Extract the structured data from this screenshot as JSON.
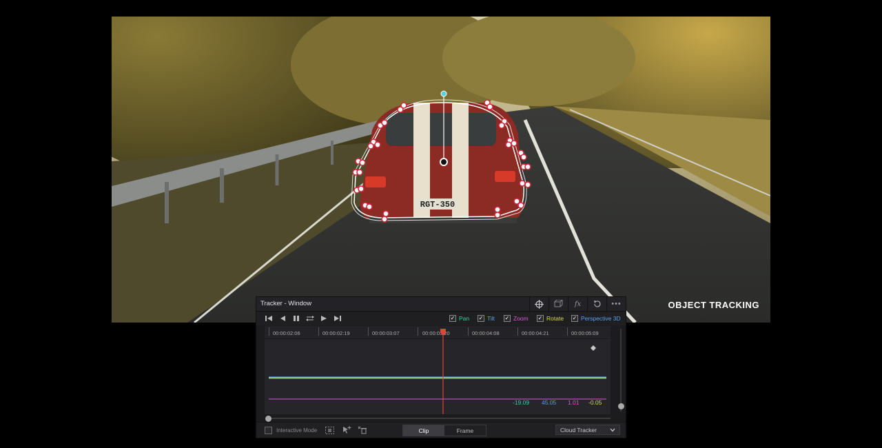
{
  "viewer": {
    "feature_label": "OBJECT TRACKING",
    "plate_text": "RGT-350"
  },
  "tracker": {
    "title": "Tracker - Window",
    "header_icons": [
      "crosshair-icon",
      "cube-icon",
      "fx-icon",
      "reset-icon",
      "more-icon"
    ],
    "transport": [
      "skip-start-icon",
      "step-back-icon",
      "stop-icon",
      "bidirectional-icon",
      "play-icon",
      "skip-end-icon"
    ],
    "options": [
      {
        "label": "Pan",
        "color": "#48c9a0",
        "checked": true
      },
      {
        "label": "Tilt",
        "color": "#5aa0ef",
        "checked": true
      },
      {
        "label": "Zoom",
        "color": "#d45ad8",
        "checked": true
      },
      {
        "label": "Rotate",
        "color": "#d8d660",
        "checked": true
      },
      {
        "label": "Perspective 3D",
        "color": "#5aa0ef",
        "checked": true
      }
    ],
    "timecodes": [
      "00:00:02:06",
      "00:00:02:19",
      "00:00:03:07",
      "00:00:03:20",
      "00:00:04:08",
      "00:00:04:21",
      "00:00:05:09"
    ],
    "values": [
      {
        "text": "-19.09",
        "color": "#48c9a0"
      },
      {
        "text": "45.05",
        "color": "#5aa0ef"
      },
      {
        "text": "1.01",
        "color": "#d45ad8"
      },
      {
        "text": "-0.05",
        "color": "#d8d660"
      }
    ],
    "footer": {
      "interactive_mode": "Interactive Mode",
      "mode_tabs": [
        "Clip",
        "Frame"
      ],
      "active_tab": "Clip",
      "tracker_select": "Cloud Tracker"
    }
  }
}
